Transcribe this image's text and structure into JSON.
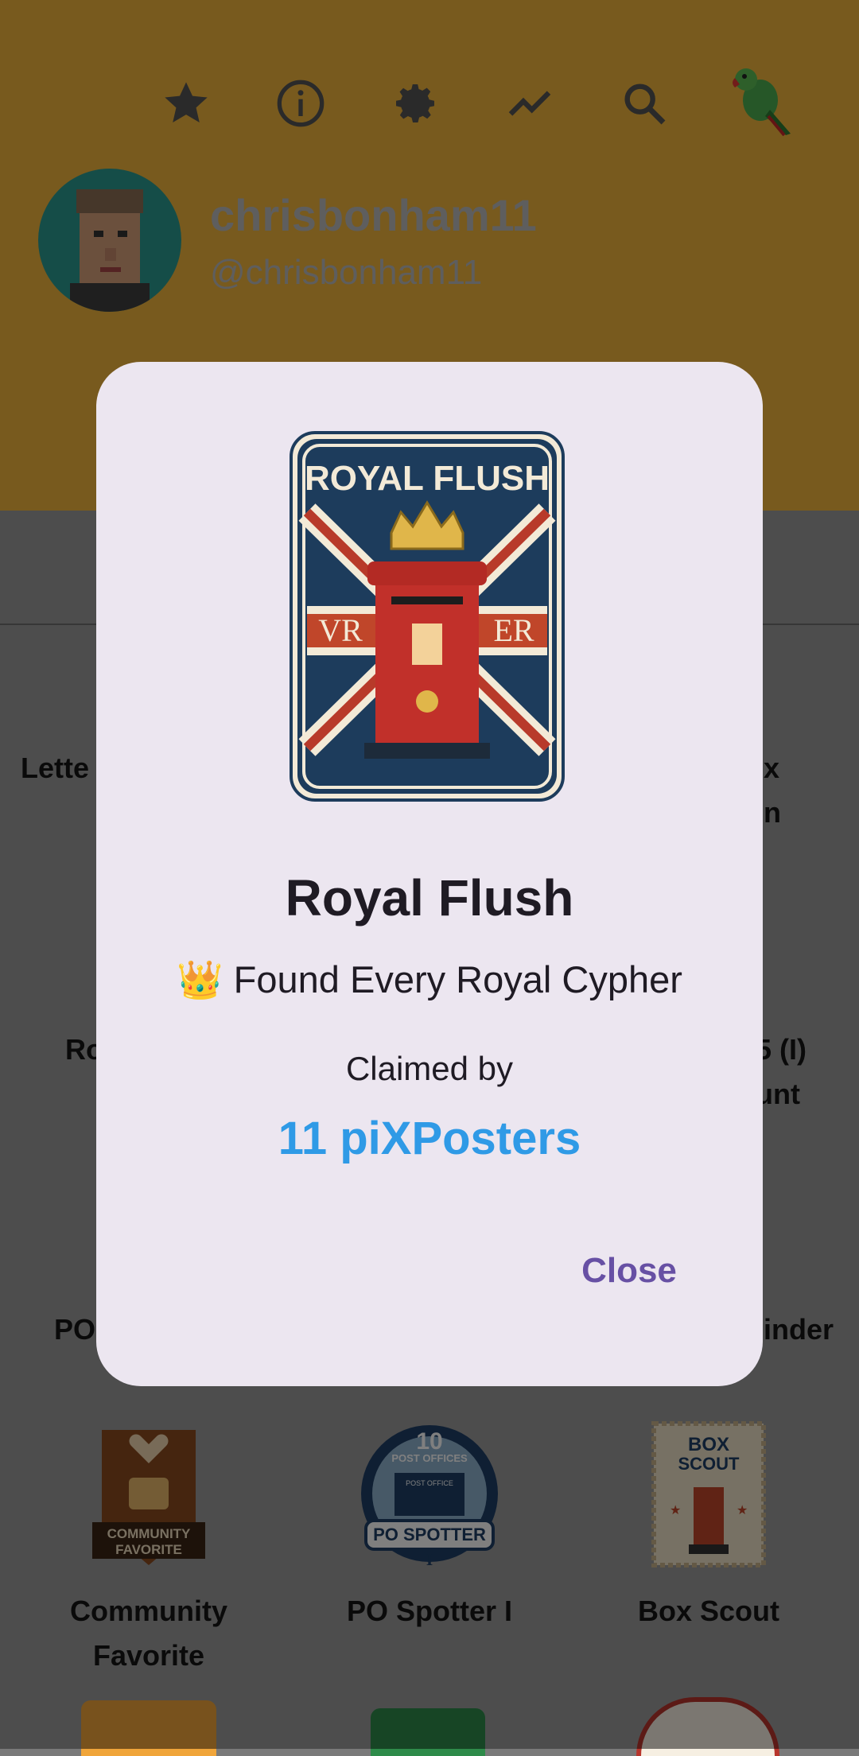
{
  "header": {
    "username": "chrisbonham11",
    "handle": "@chrisbonham11",
    "icons": [
      "star-icon",
      "info-icon",
      "gear-icon",
      "trending-icon",
      "search-icon",
      "parrot-icon"
    ]
  },
  "badges": {
    "row1_left": "Lette",
    "row1_right_a": "x",
    "row1_right_b": "n",
    "row2_left": "Ro",
    "row2_right_a": "5 (I)",
    "row2_right_b": "unt",
    "row3_left": "PO",
    "row3_right": "inder",
    "community_a": "Community",
    "community_b": "Favorite",
    "po_spotter": "PO Spotter I",
    "box_scout": "Box Scout",
    "badge_text": {
      "community": "COMMUNITY",
      "favorite": "FAVORITE",
      "po_count": "10",
      "post_offices": "POST OFFICES",
      "post_office": "POST OFFICE",
      "po_spotter": "PO SPOTTER",
      "roman_one": "I",
      "box": "BOX",
      "scout": "SCOUT"
    }
  },
  "dialog": {
    "title": "Royal Flush",
    "description": "👑 Found Every Royal Cypher",
    "claimed_label": "Claimed by",
    "claimed_count": "11 piXPosters",
    "close_label": "Close",
    "badge_image_text": {
      "banner": "ROYAL FLUSH",
      "left_cypher": "VR",
      "right_cypher": "ER"
    }
  },
  "colors": {
    "header_bg": "#f0b43c",
    "dialog_bg": "#ece6f0",
    "accent_blue": "#2f9ae6",
    "close_purple": "#6750a4"
  }
}
